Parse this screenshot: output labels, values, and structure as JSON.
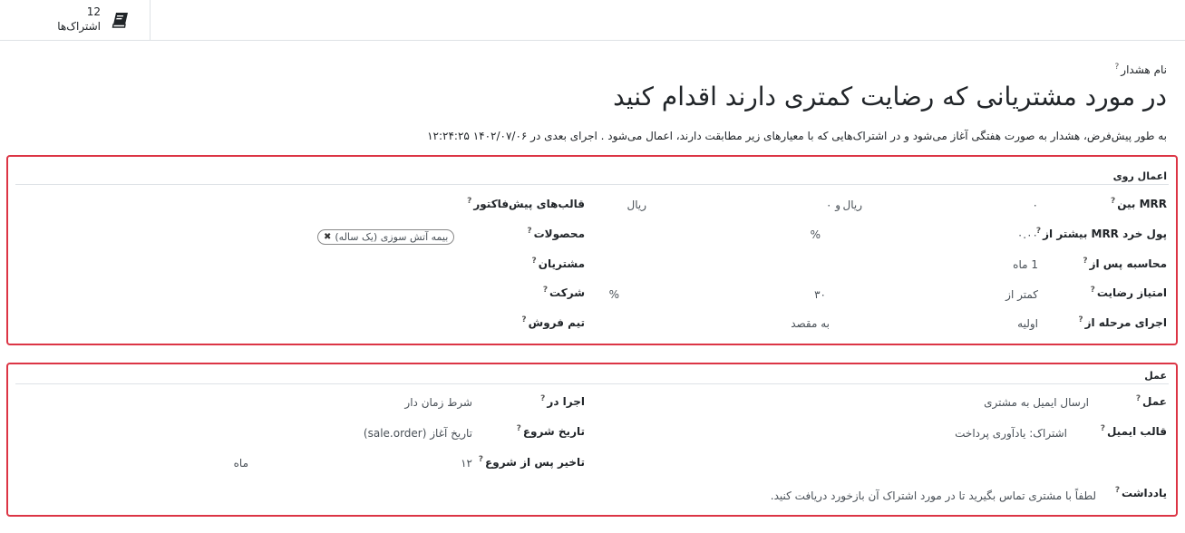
{
  "stat_button": {
    "count": "12",
    "label": "اشتراک‌ها",
    "icon": "book-icon"
  },
  "alert_name_label": "نام هشدار",
  "title": "در مورد مشتریانی که رضایت کمتری دارند اقدام کنید",
  "description": "به طور پیش‌فرض، هشدار به صورت هفتگی آغاز می‌شود و در اشتراک‌هایی که با معیارهای زیر مطابقت دارند، اعمال می‌شود . اجرای بعدی در ۱۴۰۲/۰۷/۰۶ ۱۲:۲۴:۲۵",
  "help_mark": "?",
  "apply_on": {
    "heading": "اعمال روی",
    "mrr_between": {
      "label": "MRR بین",
      "from": "۰",
      "from_currency": "ریال",
      "and": "و ۰",
      "to_currency": "ریال"
    },
    "mrr_change": {
      "label": "پول خرد MRR بیشتر از",
      "value": "۰.۰۰",
      "unit": "%"
    },
    "computed_after": {
      "label": "محاسبه پس از",
      "value": "1 ماه"
    },
    "satisfaction": {
      "label": "امتیاز رضایت",
      "op": "کمتر از",
      "value": "۳۰",
      "unit": "%"
    },
    "stage": {
      "label": "اجرای مرحله از",
      "from": "اولیه",
      "to": "به مقصد"
    },
    "quote_templates": {
      "label": "قالب‌های پیش‌فاکتور"
    },
    "products": {
      "label": "محصولات",
      "tags": [
        "بیمه آتش سوزی (یک ساله)"
      ]
    },
    "customers": {
      "label": "مشتریان"
    },
    "company": {
      "label": "شرکت"
    },
    "sales_team": {
      "label": "تیم فروش"
    }
  },
  "action": {
    "heading": "عمل",
    "action": {
      "label": "عمل",
      "value": "ارسال ایمیل به مشتری"
    },
    "email_template": {
      "label": "قالب ایمیل",
      "value": "اشتراک: یادآوری پرداخت"
    },
    "note": {
      "label": "یادداشت",
      "value": "لطفاً با مشتری تماس بگیرید تا در مورد اشتراک آن بازخورد دریافت کنید."
    },
    "execute_on": {
      "label": "اجرا در",
      "value": "شرط زمان دار"
    },
    "start_date": {
      "label": "تاریخ شروع",
      "value": "تاریخ آغاز (sale.order)"
    },
    "delay": {
      "label": "تاخیر پس از شروع",
      "value": "۱۲",
      "unit": "ماه"
    }
  },
  "colors": {
    "highlight_border": "#dc3545",
    "divider": "#dee2e6"
  }
}
